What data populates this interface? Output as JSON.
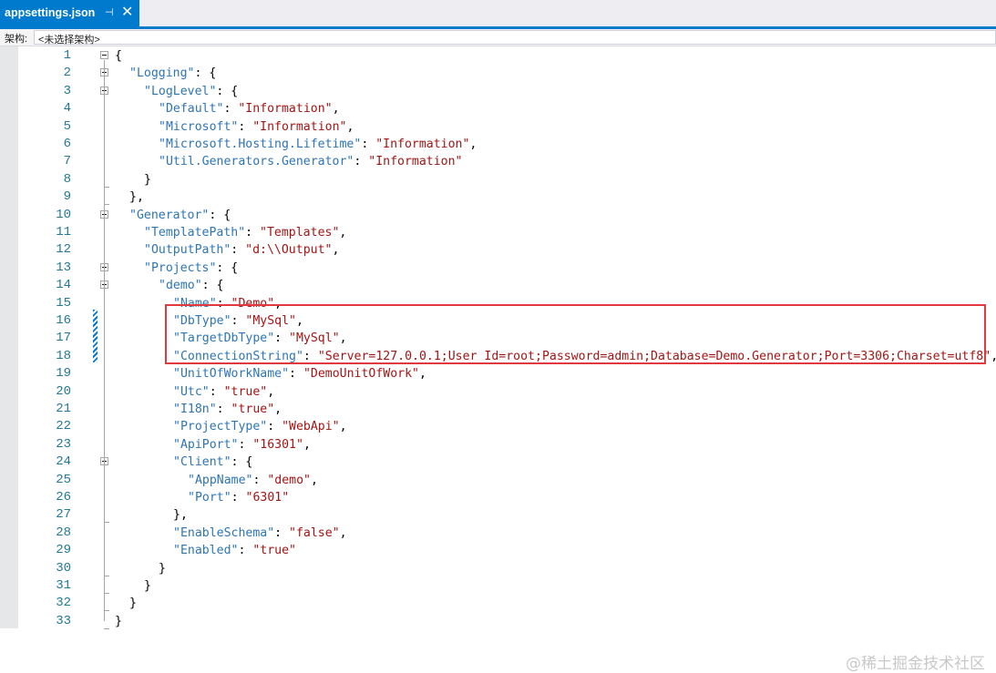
{
  "tab": {
    "title": "appsettings.json",
    "pin_glyph": "⊣",
    "pin_icon": "pin-icon",
    "close_glyph": "✕",
    "close_icon": "close-icon"
  },
  "navbar": {
    "label": "架构:",
    "schema_value": "<未选择架构>"
  },
  "editor": {
    "lines": [
      {
        "n": "1",
        "i": 0,
        "t": [
          [
            "p",
            "{"
          ]
        ]
      },
      {
        "n": "2",
        "i": 1,
        "t": [
          [
            "k",
            "\"Logging\""
          ],
          [
            "p",
            ": {"
          ]
        ]
      },
      {
        "n": "3",
        "i": 2,
        "t": [
          [
            "k",
            "\"LogLevel\""
          ],
          [
            "p",
            ": {"
          ]
        ]
      },
      {
        "n": "4",
        "i": 3,
        "t": [
          [
            "k",
            "\"Default\""
          ],
          [
            "p",
            ": "
          ],
          [
            "v",
            "\"Information\""
          ],
          [
            "p",
            ","
          ]
        ]
      },
      {
        "n": "5",
        "i": 3,
        "t": [
          [
            "k",
            "\"Microsoft\""
          ],
          [
            "p",
            ": "
          ],
          [
            "v",
            "\"Information\""
          ],
          [
            "p",
            ","
          ]
        ]
      },
      {
        "n": "6",
        "i": 3,
        "t": [
          [
            "k",
            "\"Microsoft.Hosting.Lifetime\""
          ],
          [
            "p",
            ": "
          ],
          [
            "v",
            "\"Information\""
          ],
          [
            "p",
            ","
          ]
        ]
      },
      {
        "n": "7",
        "i": 3,
        "t": [
          [
            "k",
            "\"Util.Generators.Generator\""
          ],
          [
            "p",
            ": "
          ],
          [
            "v",
            "\"Information\""
          ]
        ]
      },
      {
        "n": "8",
        "i": 2,
        "t": [
          [
            "p",
            "}"
          ]
        ]
      },
      {
        "n": "9",
        "i": 1,
        "t": [
          [
            "p",
            "},"
          ]
        ]
      },
      {
        "n": "10",
        "i": 1,
        "t": [
          [
            "k",
            "\"Generator\""
          ],
          [
            "p",
            ": {"
          ]
        ]
      },
      {
        "n": "11",
        "i": 2,
        "t": [
          [
            "k",
            "\"TemplatePath\""
          ],
          [
            "p",
            ": "
          ],
          [
            "v",
            "\"Templates\""
          ],
          [
            "p",
            ","
          ]
        ]
      },
      {
        "n": "12",
        "i": 2,
        "t": [
          [
            "k",
            "\"OutputPath\""
          ],
          [
            "p",
            ": "
          ],
          [
            "v",
            "\"d:\\\\Output\""
          ],
          [
            "p",
            ","
          ]
        ]
      },
      {
        "n": "13",
        "i": 2,
        "t": [
          [
            "k",
            "\"Projects\""
          ],
          [
            "p",
            ": {"
          ]
        ]
      },
      {
        "n": "14",
        "i": 3,
        "t": [
          [
            "k",
            "\"demo\""
          ],
          [
            "p",
            ": {"
          ]
        ]
      },
      {
        "n": "15",
        "i": 4,
        "t": [
          [
            "k",
            "\"Name\""
          ],
          [
            "p",
            ": "
          ],
          [
            "v",
            "\"Demo\""
          ],
          [
            "p",
            ","
          ]
        ]
      },
      {
        "n": "16",
        "i": 4,
        "t": [
          [
            "k",
            "\"DbType\""
          ],
          [
            "p",
            ": "
          ],
          [
            "v",
            "\"MySql\""
          ],
          [
            "p",
            ","
          ]
        ]
      },
      {
        "n": "17",
        "i": 4,
        "t": [
          [
            "k",
            "\"TargetDbType\""
          ],
          [
            "p",
            ": "
          ],
          [
            "v",
            "\"MySql\""
          ],
          [
            "p",
            ","
          ]
        ]
      },
      {
        "n": "18",
        "i": 4,
        "t": [
          [
            "k",
            "\"ConnectionString\""
          ],
          [
            "p",
            ": "
          ],
          [
            "v",
            "\"Server=127.0.0.1;User Id=root;Password=admin;Database=Demo.Generator;Port=3306;Charset=utf8\""
          ],
          [
            "p",
            ","
          ]
        ]
      },
      {
        "n": "19",
        "i": 4,
        "t": [
          [
            "k",
            "\"UnitOfWorkName\""
          ],
          [
            "p",
            ": "
          ],
          [
            "v",
            "\"DemoUnitOfWork\""
          ],
          [
            "p",
            ","
          ]
        ]
      },
      {
        "n": "20",
        "i": 4,
        "t": [
          [
            "k",
            "\"Utc\""
          ],
          [
            "p",
            ": "
          ],
          [
            "v",
            "\"true\""
          ],
          [
            "p",
            ","
          ]
        ]
      },
      {
        "n": "21",
        "i": 4,
        "t": [
          [
            "k",
            "\"I18n\""
          ],
          [
            "p",
            ": "
          ],
          [
            "v",
            "\"true\""
          ],
          [
            "p",
            ","
          ]
        ]
      },
      {
        "n": "22",
        "i": 4,
        "t": [
          [
            "k",
            "\"ProjectType\""
          ],
          [
            "p",
            ": "
          ],
          [
            "v",
            "\"WebApi\""
          ],
          [
            "p",
            ","
          ]
        ]
      },
      {
        "n": "23",
        "i": 4,
        "t": [
          [
            "k",
            "\"ApiPort\""
          ],
          [
            "p",
            ": "
          ],
          [
            "v",
            "\"16301\""
          ],
          [
            "p",
            ","
          ]
        ]
      },
      {
        "n": "24",
        "i": 4,
        "t": [
          [
            "k",
            "\"Client\""
          ],
          [
            "p",
            ": {"
          ]
        ]
      },
      {
        "n": "25",
        "i": 5,
        "t": [
          [
            "k",
            "\"AppName\""
          ],
          [
            "p",
            ": "
          ],
          [
            "v",
            "\"demo\""
          ],
          [
            "p",
            ","
          ]
        ]
      },
      {
        "n": "26",
        "i": 5,
        "t": [
          [
            "k",
            "\"Port\""
          ],
          [
            "p",
            ": "
          ],
          [
            "v",
            "\"6301\""
          ]
        ]
      },
      {
        "n": "27",
        "i": 4,
        "t": [
          [
            "p",
            "},"
          ]
        ]
      },
      {
        "n": "28",
        "i": 4,
        "t": [
          [
            "k",
            "\"EnableSchema\""
          ],
          [
            "p",
            ": "
          ],
          [
            "v",
            "\"false\""
          ],
          [
            "p",
            ","
          ]
        ]
      },
      {
        "n": "29",
        "i": 4,
        "t": [
          [
            "k",
            "\"Enabled\""
          ],
          [
            "p",
            ": "
          ],
          [
            "v",
            "\"true\""
          ]
        ]
      },
      {
        "n": "30",
        "i": 3,
        "t": [
          [
            "p",
            "}"
          ]
        ]
      },
      {
        "n": "31",
        "i": 2,
        "t": [
          [
            "p",
            "}"
          ]
        ]
      },
      {
        "n": "32",
        "i": 1,
        "t": [
          [
            "p",
            "}"
          ]
        ]
      },
      {
        "n": "33",
        "i": 0,
        "t": [
          [
            "p",
            "}"
          ]
        ]
      }
    ]
  },
  "watermark": "@稀土掘金技术社区",
  "colors": {
    "accent": "#007acc",
    "json_key": "#2e75b6",
    "json_string": "#a31515",
    "line_number": "#237893",
    "highlight_box": "#e0393e"
  }
}
